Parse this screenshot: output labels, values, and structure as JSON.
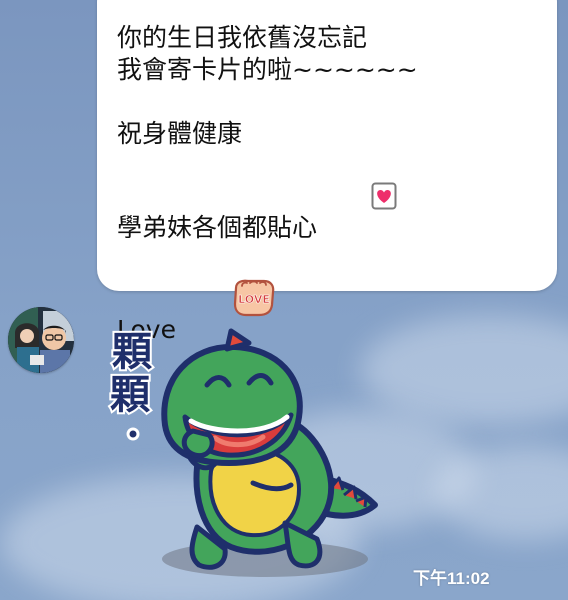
{
  "message": {
    "lines": [
      "你的生日我依舊沒忘記",
      "我會寄卡片的啦~~~~~~",
      "",
      "祝身體健康",
      "學弟妹各個都貼心",
      "",
      "Love"
    ],
    "inline_icons": {
      "line_5": "heart-card-icon",
      "line_7": "love-fist-sticker-icon"
    }
  },
  "sticker": {
    "caption": "顆顆。",
    "icon": "green-dinosaur-sticker"
  },
  "timestamp": "下午11:02",
  "colors": {
    "chat_background": "#86a2c8",
    "bubble": "#ffffff",
    "dinosaur_green": "#43a55b",
    "dinosaur_belly": "#f1d347",
    "sticker_text": "#1f2f6b"
  }
}
